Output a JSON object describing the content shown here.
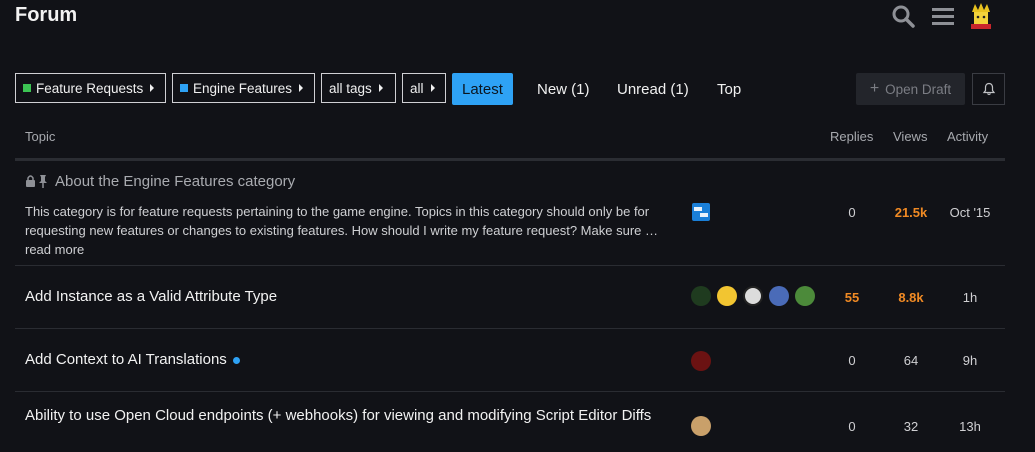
{
  "header": {
    "title": "Forum",
    "icons": [
      "search-icon",
      "menu-icon"
    ]
  },
  "filters": {
    "category": {
      "label": "Feature Requests",
      "color": "#3cc453"
    },
    "subcategory": {
      "label": "Engine Features",
      "color": "#2ea2f5"
    },
    "tags": "all tags",
    "all": "all"
  },
  "tabs": {
    "latest": "Latest",
    "new": "New (1)",
    "unread": "Unread (1)",
    "top": "Top"
  },
  "actions": {
    "open_draft": "Open Draft"
  },
  "table": {
    "headers": {
      "topic": "Topic",
      "replies": "Replies",
      "views": "Views",
      "activity": "Activity"
    },
    "rows": [
      {
        "title": "About the Engine Features category",
        "excerpt": "This category is for feature requests pertaining to the game engine. Topics in this category should only be for requesting new features or changes to existing features. How should I write my feature request? Make sure … read more",
        "replies": "0",
        "views": "21.5k",
        "activity": "Oct '15"
      },
      {
        "title": "Add Instance as a Valid Attribute Type",
        "replies": "55",
        "views": "8.8k",
        "activity": "1h"
      },
      {
        "title": "Add Context to AI Translations",
        "replies": "0",
        "views": "64",
        "activity": "9h"
      },
      {
        "title": "Ability to use Open Cloud endpoints (+ webhooks) for viewing and modifying Script Editor Diffs",
        "replies": "0",
        "views": "32",
        "activity": "13h"
      }
    ]
  },
  "colors": {
    "accent": "#2ea2f5",
    "hot": "#f08a24",
    "background": "#111217"
  }
}
